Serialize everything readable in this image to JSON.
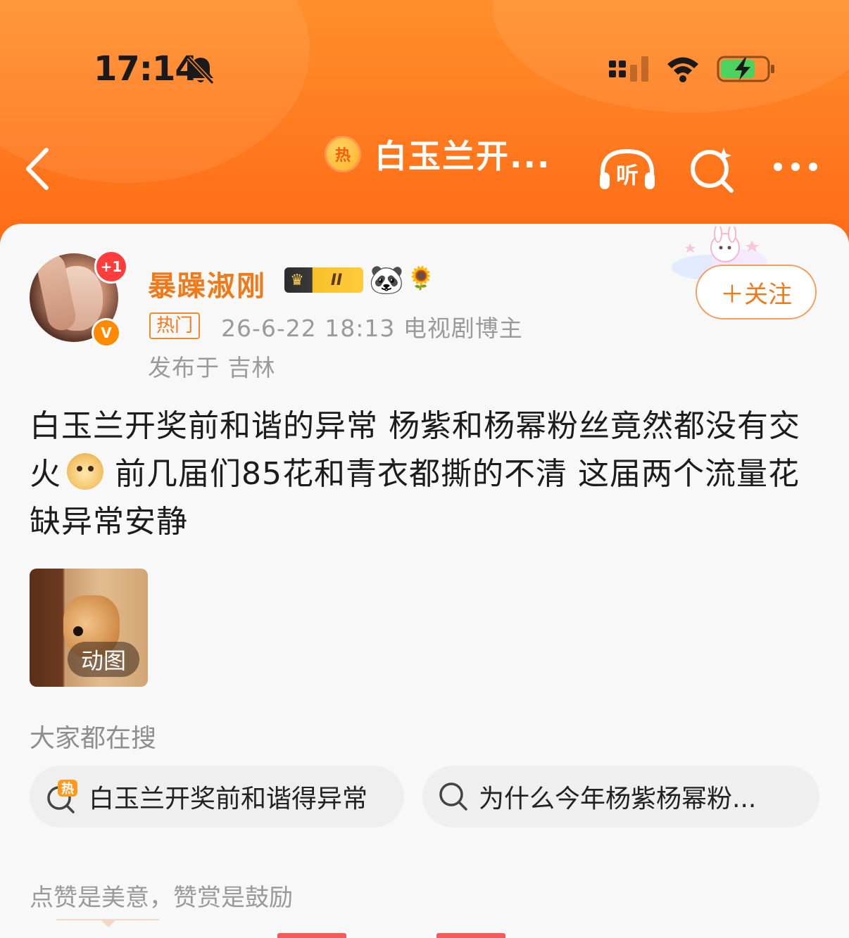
{
  "status_bar": {
    "time": "17:14"
  },
  "nav": {
    "hot_badge": "热",
    "title": "白玉兰开...",
    "listen_label": "听"
  },
  "post": {
    "avatar_badge": "+1",
    "verified_mark": "V",
    "user_name": "暴躁淑刚",
    "level_badge": "II",
    "hot_tag": "热门",
    "meta": "26-6-22 18:13  电视剧博主",
    "location": "发布于 吉林",
    "follow_label": "＋关注",
    "text_part1": "白玉兰开奖前和谐的异常 杨紫和杨幂粉丝竟然都没有交火",
    "text_part2": "前几届们85花和青衣都撕的不清 这届两个流量花缺异常安静",
    "gif_label": "动图"
  },
  "search_section": {
    "title": "大家都在搜",
    "chips": [
      {
        "label": "白玉兰开奖前和谐得异常",
        "icon": "hot-search-icon"
      },
      {
        "label": "为什么今年杨紫杨幂粉...",
        "icon": "search-icon"
      }
    ]
  },
  "footer": {
    "reward_text": "点赞是美意，赞赏是鼓励"
  },
  "colors": {
    "accent": "#ff7a1c",
    "name": "#f07a1a",
    "text": "#1c1c1c",
    "muted": "#9a9a9a"
  }
}
